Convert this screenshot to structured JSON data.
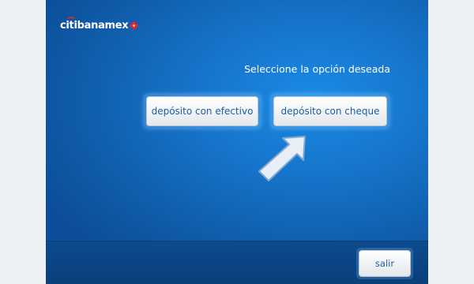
{
  "brand": {
    "logo_text": "citibanamex",
    "logo_accent_color": "#e3262f"
  },
  "main": {
    "prompt": "Seleccione la opción deseada",
    "options": [
      {
        "label": "depósito con efectivo"
      },
      {
        "label": "depósito con cheque"
      }
    ],
    "highlight_icon": "arrow-pointer-icon"
  },
  "footer": {
    "exit_label": "salir"
  },
  "colors": {
    "screen_blue": "#1673c9",
    "bottom_bar": "#0c4787",
    "button_text": "#1b5fa3"
  }
}
